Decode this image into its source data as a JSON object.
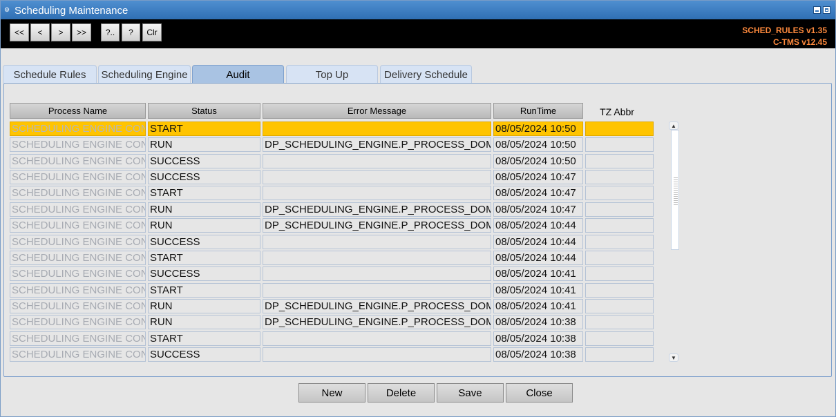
{
  "window": {
    "title": "Scheduling Maintenance"
  },
  "toolbar": {
    "buttons": [
      {
        "label": "<<"
      },
      {
        "label": "<"
      },
      {
        "label": ">"
      },
      {
        "label": ">>"
      },
      {
        "label": "?.."
      },
      {
        "label": "?"
      },
      {
        "label": "Clr"
      }
    ],
    "version_module": "SCHED_RULES v1.35",
    "version_app": "C-TMS v12.45",
    "version_color": "#ff8a3d"
  },
  "tabs": [
    {
      "label": "Schedule Rules",
      "active": false
    },
    {
      "label": "Scheduling Engine",
      "active": false
    },
    {
      "label": "Audit",
      "active": true
    },
    {
      "label": "Top Up",
      "active": false
    },
    {
      "label": "Delivery Schedule",
      "active": false
    }
  ],
  "table": {
    "columns": [
      "Process Name",
      "Status",
      "Error Message",
      "RunTime",
      "TZ Abbr"
    ],
    "selected_row": 0,
    "selection_color": "#ffc400",
    "rows": [
      {
        "process": "SCHEDULING ENGINE CONT",
        "status": "START",
        "error": "",
        "runtime": "08/05/2024 10:50",
        "tz": ""
      },
      {
        "process": "SCHEDULING ENGINE CONT",
        "status": "RUN",
        "error": "DP_SCHEDULING_ENGINE.P_PROCESS_DOME",
        "runtime": "08/05/2024 10:50",
        "tz": ""
      },
      {
        "process": "SCHEDULING ENGINE CONT",
        "status": "SUCCESS",
        "error": "",
        "runtime": "08/05/2024 10:50",
        "tz": ""
      },
      {
        "process": "SCHEDULING ENGINE CONT",
        "status": "SUCCESS",
        "error": "",
        "runtime": "08/05/2024 10:47",
        "tz": ""
      },
      {
        "process": "SCHEDULING ENGINE CONT",
        "status": "START",
        "error": "",
        "runtime": "08/05/2024 10:47",
        "tz": ""
      },
      {
        "process": "SCHEDULING ENGINE CONT",
        "status": "RUN",
        "error": "DP_SCHEDULING_ENGINE.P_PROCESS_DOME",
        "runtime": "08/05/2024 10:47",
        "tz": ""
      },
      {
        "process": "SCHEDULING ENGINE CONT",
        "status": "RUN",
        "error": "DP_SCHEDULING_ENGINE.P_PROCESS_DOME",
        "runtime": "08/05/2024 10:44",
        "tz": ""
      },
      {
        "process": "SCHEDULING ENGINE CONT",
        "status": "SUCCESS",
        "error": "",
        "runtime": "08/05/2024 10:44",
        "tz": ""
      },
      {
        "process": "SCHEDULING ENGINE CONT",
        "status": "START",
        "error": "",
        "runtime": "08/05/2024 10:44",
        "tz": ""
      },
      {
        "process": "SCHEDULING ENGINE CONT",
        "status": "SUCCESS",
        "error": "",
        "runtime": "08/05/2024 10:41",
        "tz": ""
      },
      {
        "process": "SCHEDULING ENGINE CONT",
        "status": "START",
        "error": "",
        "runtime": "08/05/2024 10:41",
        "tz": ""
      },
      {
        "process": "SCHEDULING ENGINE CONT",
        "status": "RUN",
        "error": "DP_SCHEDULING_ENGINE.P_PROCESS_DOME",
        "runtime": "08/05/2024 10:41",
        "tz": ""
      },
      {
        "process": "SCHEDULING ENGINE CONT",
        "status": "RUN",
        "error": "DP_SCHEDULING_ENGINE.P_PROCESS_DOME",
        "runtime": "08/05/2024 10:38",
        "tz": ""
      },
      {
        "process": "SCHEDULING ENGINE CONT",
        "status": "START",
        "error": "",
        "runtime": "08/05/2024 10:38",
        "tz": ""
      },
      {
        "process": "SCHEDULING ENGINE CONT",
        "status": "SUCCESS",
        "error": "",
        "runtime": "08/05/2024 10:38",
        "tz": ""
      }
    ]
  },
  "scrollbar": {
    "up_icon": "up-arrow-icon",
    "down_icon": "down-arrow-icon"
  },
  "actions": {
    "new_label": "New",
    "delete_label": "Delete",
    "save_label": "Save",
    "close_label": "Close"
  }
}
